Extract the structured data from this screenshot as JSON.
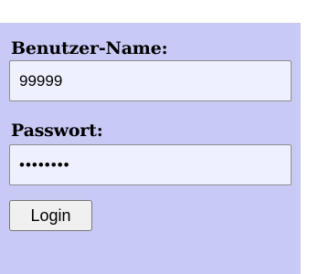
{
  "form": {
    "username_label": "Benutzer-Name:",
    "username_value": "99999",
    "password_label": "Passwort:",
    "password_value": "********",
    "login_label": "Login"
  },
  "colors": {
    "panel_background": "#c8caf5",
    "field_background": "#eef0ff"
  }
}
